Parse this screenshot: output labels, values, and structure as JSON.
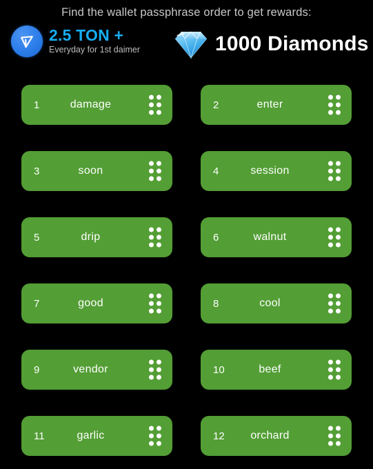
{
  "header": {
    "headline": "Find the wallet passphrase order to get rewards:",
    "ton_reward": {
      "icon": "ton-coin-icon",
      "amount": "2.5 TON +",
      "subtitle": "Everyday for 1st daimer",
      "amount_color": "#17adf2",
      "logo_color": "#2b7de9"
    },
    "diamond_reward": {
      "icon": "diamond-gem-icon",
      "amount": "1000 Diamonds",
      "amount_color": "#ffffff",
      "gem_color": "#4fb9f0"
    }
  },
  "passphrase": {
    "card_color": "#539e35",
    "text_color": "#ffffff",
    "handle_icon": "drag-handle-icon",
    "cards": [
      {
        "index": "1",
        "word": "damage"
      },
      {
        "index": "2",
        "word": "enter"
      },
      {
        "index": "3",
        "word": "soon"
      },
      {
        "index": "4",
        "word": "session"
      },
      {
        "index": "5",
        "word": "drip"
      },
      {
        "index": "6",
        "word": "walnut"
      },
      {
        "index": "7",
        "word": "good"
      },
      {
        "index": "8",
        "word": "cool"
      },
      {
        "index": "9",
        "word": "vendor"
      },
      {
        "index": "10",
        "word": "beef"
      },
      {
        "index": "11",
        "word": "garlic"
      },
      {
        "index": "12",
        "word": "orchard"
      }
    ]
  },
  "background_color": "#000000"
}
